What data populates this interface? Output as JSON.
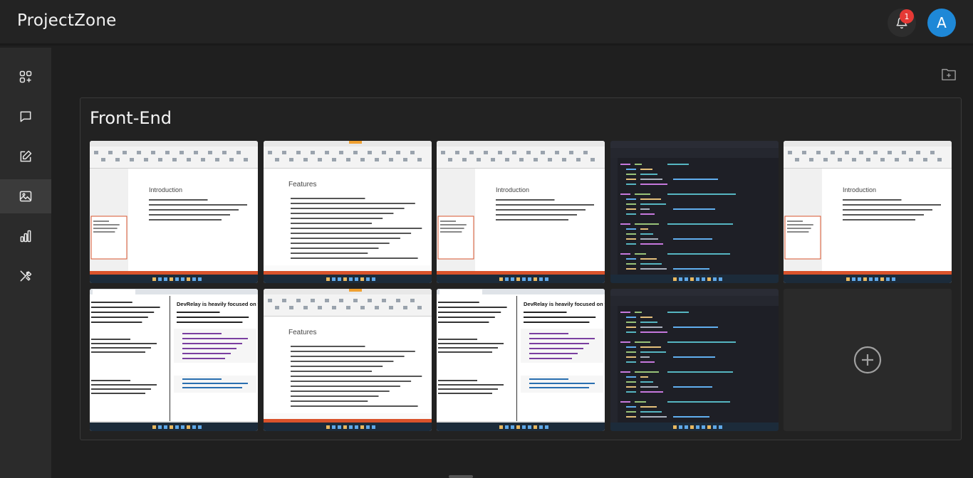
{
  "header": {
    "title": "ProjectZone",
    "notification_count": "1",
    "avatar_initial": "A"
  },
  "sidebar": {
    "items": [
      {
        "icon": "apps-add-icon"
      },
      {
        "icon": "chat-icon"
      },
      {
        "icon": "edit-icon"
      },
      {
        "icon": "image-icon",
        "active": true
      },
      {
        "icon": "bar-chart-icon"
      },
      {
        "icon": "tools-icon"
      }
    ]
  },
  "group": {
    "title": "Front-End",
    "thumbnails": [
      {
        "kind": "slides-intro",
        "heading": "Introduction"
      },
      {
        "kind": "slides-features",
        "heading": "Features"
      },
      {
        "kind": "slides-intro",
        "heading": "Introduction"
      },
      {
        "kind": "code-editor"
      },
      {
        "kind": "slides-intro",
        "heading": "Introduction"
      },
      {
        "kind": "browser-article",
        "heading": "DevRelay is heavily focused on the group of developer's there are thing you would"
      },
      {
        "kind": "slides-features",
        "heading": "Features"
      },
      {
        "kind": "browser-article",
        "heading": "DevRelay is heavily focused on the group of developer's there are thing you would"
      },
      {
        "kind": "code-editor"
      }
    ]
  },
  "colors": {
    "accent": "#1e88d7",
    "badge": "#e53935",
    "taskbar": "#1c2b3a",
    "slide_accent": "#d9532c"
  }
}
